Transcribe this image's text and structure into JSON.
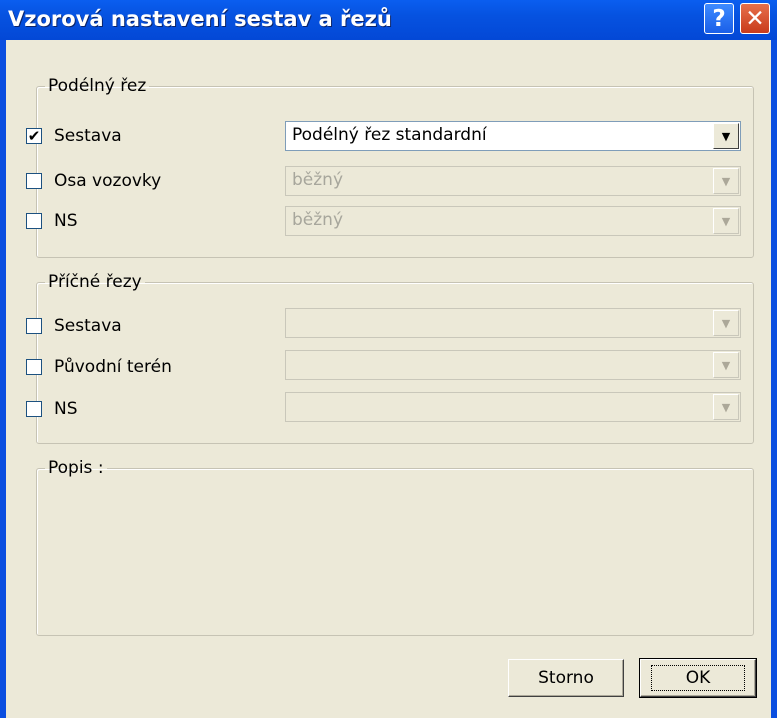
{
  "window": {
    "title": "Vzorová nastavení sestav a řezů",
    "help_glyph": "?",
    "close_glyph": "✕"
  },
  "groups": {
    "podelny": {
      "legend": "Podélný řez",
      "rows": [
        {
          "label": "Sestava",
          "checked": true,
          "combo": "Podélný řez standardní",
          "enabled": true
        },
        {
          "label": "Osa vozovky",
          "checked": false,
          "combo": "běžný",
          "enabled": false
        },
        {
          "label": "NS",
          "checked": false,
          "combo": "běžný",
          "enabled": false
        }
      ]
    },
    "pricne": {
      "legend": "Příčné řezy",
      "rows": [
        {
          "label": "Sestava",
          "checked": false,
          "combo": "",
          "enabled": false
        },
        {
          "label": "Původní terén",
          "checked": false,
          "combo": "",
          "enabled": false
        },
        {
          "label": "NS",
          "checked": false,
          "combo": "",
          "enabled": false
        }
      ]
    },
    "popis": {
      "legend": "Popis :"
    }
  },
  "buttons": {
    "cancel": "Storno",
    "ok": "OK"
  },
  "icons": {
    "check": "✔",
    "dropdown": "▼"
  }
}
